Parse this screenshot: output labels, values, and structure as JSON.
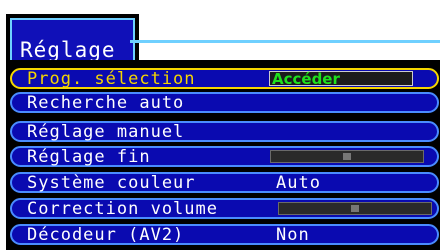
{
  "title": "Réglage",
  "menu": {
    "items": [
      {
        "label": "Prog. sélection",
        "value": "Accéder",
        "kind": "access",
        "selected": true
      },
      {
        "label": "Recherche auto",
        "value": "",
        "kind": "none",
        "selected": false
      },
      {
        "label": "Réglage manuel",
        "value": "",
        "kind": "none",
        "selected": false
      },
      {
        "label": "Réglage fin",
        "value": "",
        "kind": "slider",
        "level": 0.5,
        "selected": false
      },
      {
        "label": "Système couleur",
        "value": "Auto",
        "kind": "text",
        "selected": false
      },
      {
        "label": "Correction volume",
        "value": "",
        "kind": "slider",
        "level": 0.5,
        "selected": false
      },
      {
        "label": "Décodeur (AV2)",
        "value": "Non",
        "kind": "text",
        "selected": false
      }
    ]
  },
  "colors": {
    "panel": "#000000",
    "row": "#0a0ab0",
    "row_border": "#4a8cff",
    "selected_border": "#f5d600",
    "selected_text": "#f5d600",
    "access_text": "#1ee01e",
    "text": "#ffffff"
  }
}
